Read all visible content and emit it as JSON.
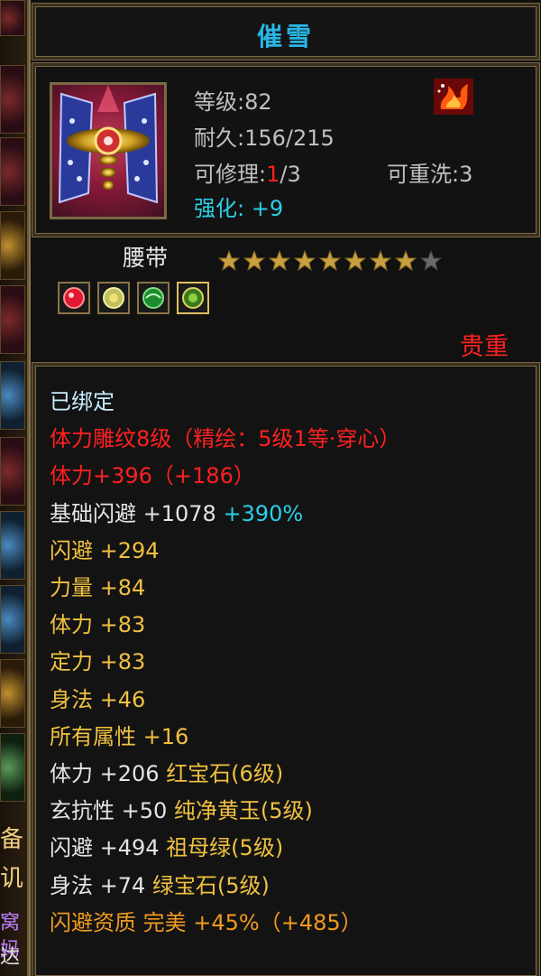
{
  "item": {
    "name": "催雪",
    "level_label": "等级",
    "level_value": ":82",
    "durability_label": "耐久",
    "durability_value": ":156/215",
    "repair_label": "可修理:",
    "repair_used": "1",
    "repair_total": "/3",
    "reroll_label": "可重洗",
    "reroll_value": ":3",
    "enhance_label": "强化:",
    "enhance_value": "+9",
    "type": "腰带",
    "stars_filled": 8,
    "stars_total": 9,
    "quality": "贵重",
    "gems": [
      "red-gem-icon",
      "yellow-gem-icon",
      "green-gem-icon",
      "jade-gem-icon"
    ]
  },
  "stats": [
    {
      "text": "已绑定",
      "color": "lightblue"
    },
    {
      "text": "体力雕纹8级（精绘：5级1等·穿心）",
      "color": "red"
    },
    {
      "text": "体力+396（+186）",
      "color": "red"
    },
    {
      "text": "基础闪避 +1078 ",
      "color": "white",
      "extra": "+390%",
      "extra_color": "cyan"
    },
    {
      "text": "闪避 +294",
      "color": "gold"
    },
    {
      "text": "力量 +84",
      "color": "gold"
    },
    {
      "text": "体力 +83",
      "color": "gold"
    },
    {
      "text": "定力 +83",
      "color": "gold"
    },
    {
      "text": "身法 +46",
      "color": "gold"
    },
    {
      "text": "所有属性 +16",
      "color": "gold"
    },
    {
      "text": "体力 +206 ",
      "color": "white",
      "extra": "红宝石(6级)",
      "extra_color": "gold"
    },
    {
      "text": "玄抗性 +50 ",
      "color": "white",
      "extra": "纯净黄玉(5级)",
      "extra_color": "gold"
    },
    {
      "text": "闪避 +494 ",
      "color": "white",
      "extra": "祖母绿(5级)",
      "extra_color": "gold"
    },
    {
      "text": "身法 +74 ",
      "color": "white",
      "extra": "绿宝石(5级)",
      "extra_color": "gold"
    },
    {
      "text": "闪避资质  完美 +45%（+485）",
      "color": "orange"
    }
  ],
  "sidebar": {
    "label_1": "备",
    "label_2": "讥",
    "label_3": "窝妈",
    "label_4": "达"
  }
}
